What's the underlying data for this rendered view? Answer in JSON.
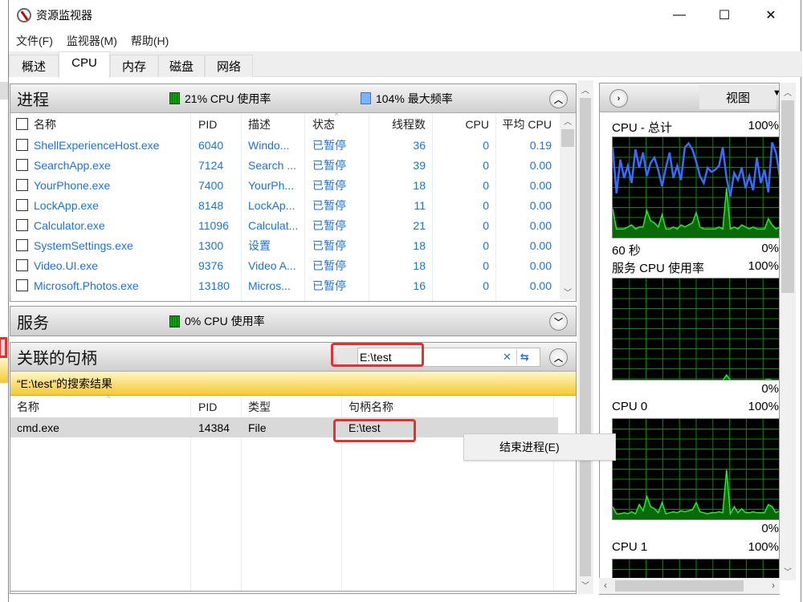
{
  "window": {
    "title": "资源监视器",
    "controls": {
      "minimize": "—",
      "maximize": "☐",
      "close": "✕"
    }
  },
  "menu": [
    "文件(F)",
    "监视器(M)",
    "帮助(H)"
  ],
  "tabs": [
    {
      "label": "概述",
      "active": false
    },
    {
      "label": "CPU",
      "active": true
    },
    {
      "label": "内存",
      "active": false
    },
    {
      "label": "磁盘",
      "active": false
    },
    {
      "label": "网络",
      "active": false
    }
  ],
  "processes": {
    "title": "进程",
    "cpu_usage": "21% CPU 使用率",
    "max_freq": "104% 最大频率",
    "columns": [
      "名称",
      "PID",
      "描述",
      "状态",
      "线程数",
      "CPU",
      "平均 CPU"
    ],
    "rows": [
      {
        "name": "ShellExperienceHost.exe",
        "pid": "6040",
        "desc": "Windo...",
        "status": "已暂停",
        "threads": "36",
        "cpu": "0",
        "avg": "0.19"
      },
      {
        "name": "SearchApp.exe",
        "pid": "7124",
        "desc": "Search ...",
        "status": "已暂停",
        "threads": "39",
        "cpu": "0",
        "avg": "0.00"
      },
      {
        "name": "YourPhone.exe",
        "pid": "7400",
        "desc": "YourPh...",
        "status": "已暂停",
        "threads": "18",
        "cpu": "0",
        "avg": "0.00"
      },
      {
        "name": "LockApp.exe",
        "pid": "8148",
        "desc": "LockAp...",
        "status": "已暂停",
        "threads": "11",
        "cpu": "0",
        "avg": "0.00"
      },
      {
        "name": "Calculator.exe",
        "pid": "11096",
        "desc": "Calculat...",
        "status": "已暂停",
        "threads": "21",
        "cpu": "0",
        "avg": "0.00"
      },
      {
        "name": "SystemSettings.exe",
        "pid": "1300",
        "desc": "设置",
        "status": "已暂停",
        "threads": "18",
        "cpu": "0",
        "avg": "0.00"
      },
      {
        "name": "Video.UI.exe",
        "pid": "9376",
        "desc": "Video A...",
        "status": "已暂停",
        "threads": "18",
        "cpu": "0",
        "avg": "0.00"
      },
      {
        "name": "Microsoft.Photos.exe",
        "pid": "13180",
        "desc": "Micros...",
        "status": "已暂停",
        "threads": "16",
        "cpu": "0",
        "avg": "0.00"
      }
    ]
  },
  "services": {
    "title": "服务",
    "cpu_usage": "0% CPU 使用率"
  },
  "handles": {
    "title": "关联的句柄",
    "search_value": "E:\\test",
    "result_banner": "“E:\\test”的搜索结果",
    "columns": [
      "名称",
      "PID",
      "类型",
      "句柄名称"
    ],
    "rows": [
      {
        "name": "cmd.exe",
        "pid": "14384",
        "type": "File",
        "handle": "E:\\test"
      }
    ]
  },
  "context_menu": {
    "items": [
      "结束进程(E)"
    ]
  },
  "right_panel": {
    "view_label": "视图",
    "graphs": [
      {
        "label": "CPU - 总计",
        "max": "100%",
        "footer_left": "60 秒",
        "footer_right": "0%"
      },
      {
        "label": "服务 CPU 使用率",
        "max": "100%",
        "footer_right": "0%"
      },
      {
        "label": "CPU 0",
        "max": "100%",
        "footer_right": "0%"
      },
      {
        "label": "CPU 1",
        "max": "100%"
      }
    ],
    "cpu_total_freq_series": [
      90,
      45,
      78,
      60,
      72,
      55,
      88,
      70,
      85,
      62,
      75,
      80,
      68,
      52,
      70,
      85,
      60,
      72,
      58,
      90,
      94,
      88,
      76,
      62,
      55,
      70,
      66,
      68,
      72,
      90,
      60,
      42,
      65,
      58,
      70,
      50,
      62,
      48,
      80,
      55,
      68,
      46,
      95,
      85,
      62
    ],
    "cpu_total_usage_series": [
      30,
      10,
      10,
      10,
      12,
      14,
      10,
      12,
      12,
      28,
      18,
      16,
      12,
      24,
      10,
      10,
      12,
      10,
      14,
      12,
      14,
      16,
      26,
      12,
      10,
      10,
      10,
      10,
      12,
      10,
      50,
      10,
      12,
      10,
      14,
      12,
      10,
      12,
      10,
      10,
      10,
      20,
      14,
      10,
      12
    ],
    "service_usage_series": [
      1,
      1,
      1,
      1,
      1,
      1,
      1,
      1,
      1,
      1,
      1,
      1,
      1,
      1,
      1,
      1,
      1,
      1,
      1,
      1,
      1,
      1,
      1,
      1,
      1,
      1,
      1,
      1,
      1,
      1,
      6,
      1,
      1,
      1,
      1,
      1,
      1,
      1,
      1,
      1,
      1,
      2,
      1,
      1,
      1
    ],
    "cpu0_usage_series": [
      14,
      7,
      7,
      8,
      7,
      9,
      7,
      16,
      10,
      24,
      14,
      12,
      8,
      18,
      7,
      8,
      9,
      8,
      10,
      9,
      10,
      11,
      18,
      9,
      8,
      7,
      8,
      8,
      9,
      8,
      50,
      7,
      14,
      8,
      12,
      8,
      8,
      9,
      8,
      8,
      8,
      16,
      14,
      8,
      10
    ]
  }
}
